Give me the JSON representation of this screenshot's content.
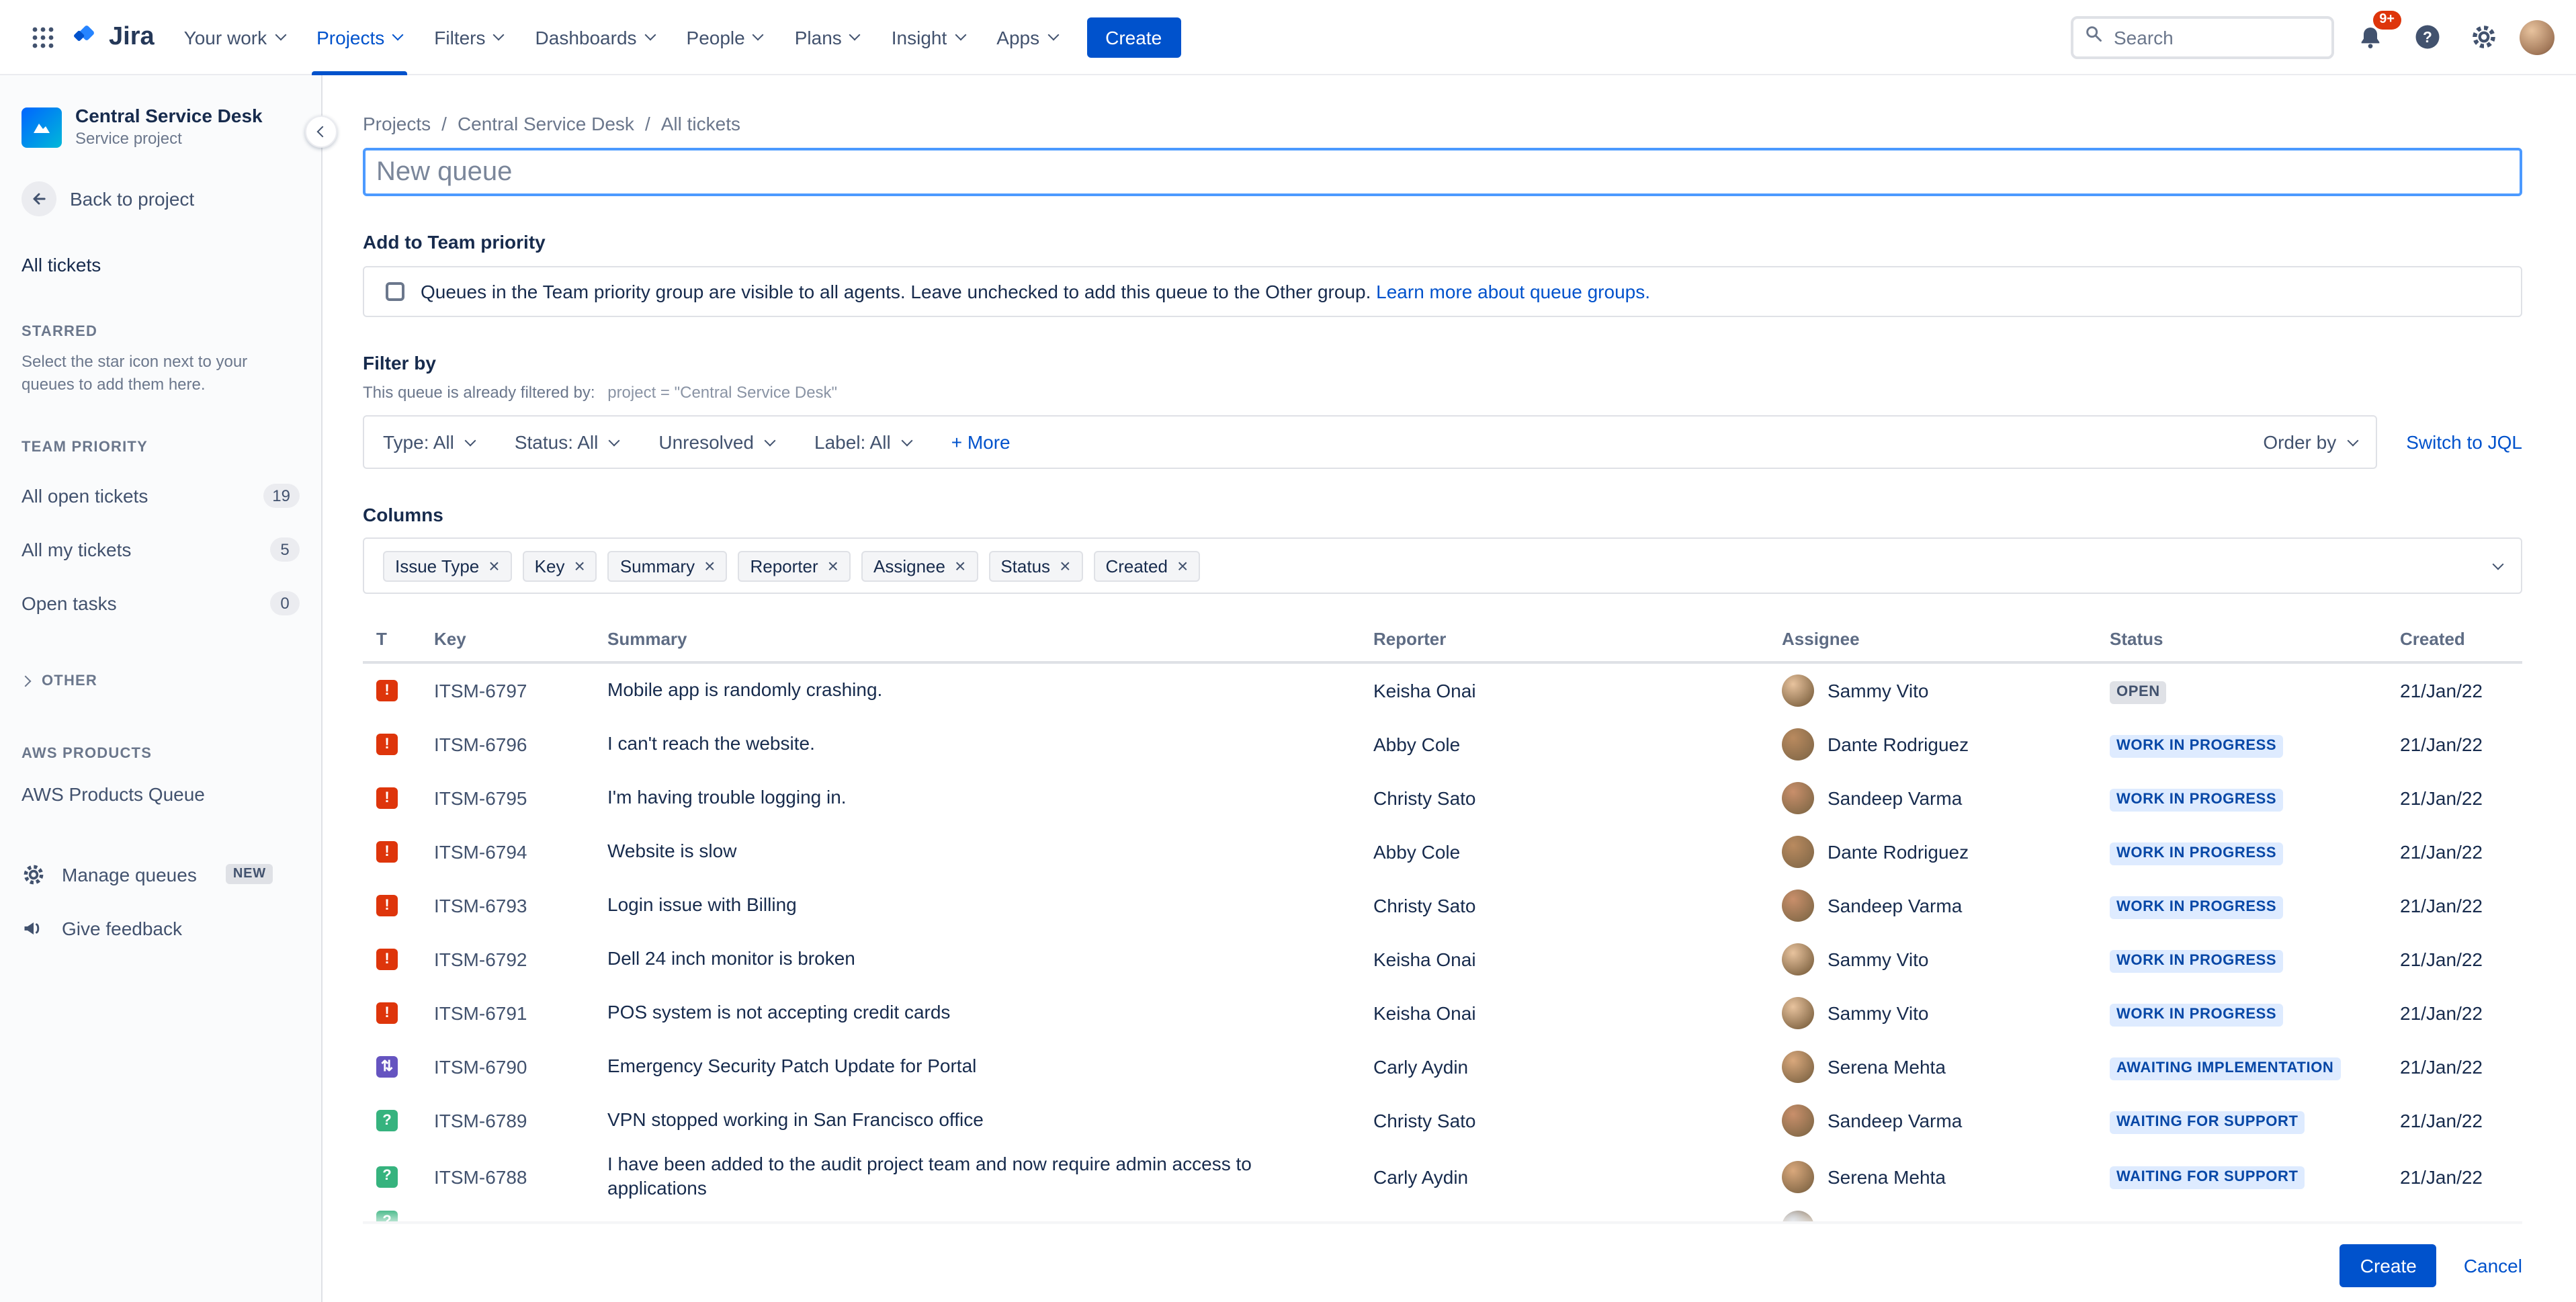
{
  "colors": {
    "accent": "#0052CC",
    "incident": "#DE350B",
    "change": "#6554C0",
    "service_request": "#36B37E",
    "lozenge_blue_bg": "#DEEBFF",
    "lozenge_blue_text": "#0747A6",
    "lozenge_gray_bg": "#DFE1E6",
    "lozenge_gray_text": "#42526E"
  },
  "avatar_colors": {
    "Sammy Vito": "#E8C39E",
    "Dante Rodriguez": "#B98A5F",
    "Sandeep Varma": "#C98F6B",
    "Serena Mehta": "#D9A87C"
  },
  "topnav": {
    "logo_text": "Jira",
    "items": [
      {
        "label": "Your work",
        "active": false
      },
      {
        "label": "Projects",
        "active": true
      },
      {
        "label": "Filters",
        "active": false
      },
      {
        "label": "Dashboards",
        "active": false
      },
      {
        "label": "People",
        "active": false
      },
      {
        "label": "Plans",
        "active": false
      },
      {
        "label": "Insight",
        "active": false
      },
      {
        "label": "Apps",
        "active": false
      }
    ],
    "create_label": "Create",
    "search_placeholder": "Search",
    "notification_badge": "9+"
  },
  "sidebar": {
    "project_name": "Central Service Desk",
    "project_type": "Service project",
    "back_label": "Back to project",
    "all_tickets_label": "All tickets",
    "starred_heading": "STARRED",
    "starred_help": "Select the star icon next to your queues to add them here.",
    "team_priority_heading": "TEAM PRIORITY",
    "queues": [
      {
        "label": "All open tickets",
        "count": "19"
      },
      {
        "label": "All my tickets",
        "count": "5"
      },
      {
        "label": "Open tasks",
        "count": "0"
      }
    ],
    "other_heading": "OTHER",
    "aws_heading": "AWS PRODUCTS",
    "aws_queue_label": "AWS Products Queue",
    "manage_queues_label": "Manage queues",
    "manage_queues_badge": "NEW",
    "give_feedback_label": "Give feedback"
  },
  "main": {
    "breadcrumb": [
      "Projects",
      "Central Service Desk",
      "All tickets"
    ],
    "queue_name_placeholder": "New queue",
    "team_priority": {
      "heading": "Add to Team priority",
      "checkbox_text": "Queues in the Team priority group are visible to all agents. Leave unchecked to add this queue to the Other group.",
      "link_text": "Learn more about queue groups."
    },
    "filter": {
      "heading": "Filter by",
      "prefilter_text": "This queue is already filtered by:",
      "prefilter_value": "project = \"Central Service Desk\"",
      "filters": [
        "Type: All",
        "Status: All",
        "Unresolved",
        "Label: All"
      ],
      "more_label": "+ More",
      "order_by_label": "Order by",
      "switch_jql_label": "Switch to JQL"
    },
    "columns": {
      "heading": "Columns",
      "chips": [
        "Issue Type",
        "Key",
        "Summary",
        "Reporter",
        "Assignee",
        "Status",
        "Created"
      ]
    },
    "table": {
      "headers": [
        "T",
        "Key",
        "Summary",
        "Reporter",
        "Assignee",
        "Status",
        "Created"
      ],
      "rows": [
        {
          "type": "incident",
          "key": "ITSM-6797",
          "summary": "Mobile app is randomly crashing.",
          "reporter": "Keisha Onai",
          "assignee": "Sammy Vito",
          "status": "OPEN",
          "status_type": "gray",
          "created": "21/Jan/22"
        },
        {
          "type": "incident",
          "key": "ITSM-6796",
          "summary": "I can't reach the website.",
          "reporter": "Abby Cole",
          "assignee": "Dante Rodriguez",
          "status": "WORK IN PROGRESS",
          "status_type": "blue",
          "created": "21/Jan/22"
        },
        {
          "type": "incident",
          "key": "ITSM-6795",
          "summary": "I'm having trouble logging in.",
          "reporter": "Christy Sato",
          "assignee": "Sandeep Varma",
          "status": "WORK IN PROGRESS",
          "status_type": "blue",
          "created": "21/Jan/22"
        },
        {
          "type": "incident",
          "key": "ITSM-6794",
          "summary": "Website is slow",
          "reporter": "Abby Cole",
          "assignee": "Dante Rodriguez",
          "status": "WORK IN PROGRESS",
          "status_type": "blue",
          "created": "21/Jan/22"
        },
        {
          "type": "incident",
          "key": "ITSM-6793",
          "summary": "Login issue with Billing",
          "reporter": "Christy Sato",
          "assignee": "Sandeep Varma",
          "status": "WORK IN PROGRESS",
          "status_type": "blue",
          "created": "21/Jan/22"
        },
        {
          "type": "incident",
          "key": "ITSM-6792",
          "summary": "Dell 24 inch monitor is broken",
          "reporter": "Keisha Onai",
          "assignee": "Sammy Vito",
          "status": "WORK IN PROGRESS",
          "status_type": "blue",
          "created": "21/Jan/22"
        },
        {
          "type": "incident",
          "key": "ITSM-6791",
          "summary": "POS system is not accepting credit cards",
          "reporter": "Keisha Onai",
          "assignee": "Sammy Vito",
          "status": "WORK IN PROGRESS",
          "status_type": "blue",
          "created": "21/Jan/22"
        },
        {
          "type": "change",
          "key": "ITSM-6790",
          "summary": "Emergency Security Patch Update for Portal",
          "reporter": "Carly Aydin",
          "assignee": "Serena Mehta",
          "status": "AWAITING IMPLEMENTATION",
          "status_type": "blue",
          "created": "21/Jan/22"
        },
        {
          "type": "service_request",
          "key": "ITSM-6789",
          "summary": "VPN stopped working in San Francisco office",
          "reporter": "Christy Sato",
          "assignee": "Sandeep Varma",
          "status": "WAITING FOR SUPPORT",
          "status_type": "blue",
          "created": "21/Jan/22"
        },
        {
          "type": "service_request",
          "key": "ITSM-6788",
          "summary": "I have been added to the audit project team and now require admin access to applications",
          "reporter": "Carly Aydin",
          "assignee": "Serena Mehta",
          "status": "WAITING FOR SUPPORT",
          "status_type": "blue",
          "created": "21/Jan/22"
        },
        {
          "type": "service_request",
          "partial": true
        }
      ]
    },
    "footer": {
      "create_label": "Create",
      "cancel_label": "Cancel"
    }
  }
}
